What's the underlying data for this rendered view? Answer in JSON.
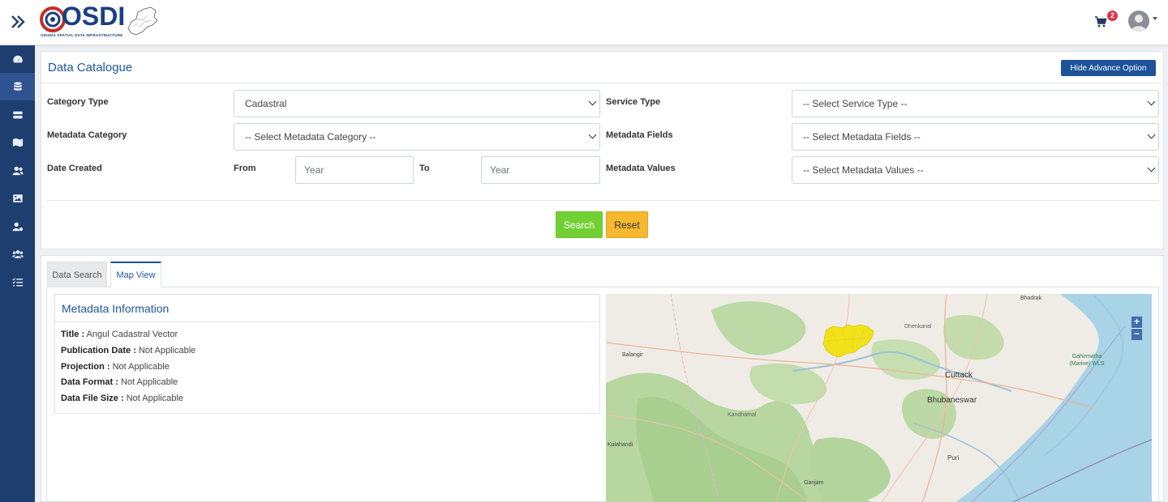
{
  "header": {
    "logo_text": "OSDI",
    "logo_subtitle": "ODISHA SPATIAL DATA INFRASTRUCTURE",
    "cart_count": "2",
    "icons": {
      "toggle": "double-chevron-right-icon",
      "cart": "cart-icon",
      "user": "user-avatar-icon"
    }
  },
  "sidebar": {
    "items": [
      {
        "icon": "dashboard-icon"
      },
      {
        "icon": "database-icon"
      },
      {
        "icon": "server-icon"
      },
      {
        "icon": "map-icon"
      },
      {
        "icon": "users-icon"
      },
      {
        "icon": "image-icon"
      },
      {
        "icon": "user-settings-icon"
      },
      {
        "icon": "user-group-icon"
      },
      {
        "icon": "checklist-icon"
      }
    ]
  },
  "catalogue": {
    "title": "Data Catalogue",
    "hide_button": "Hide Advance Option",
    "category_type_label": "Category Type",
    "category_type_value": "Cadastral",
    "service_type_label": "Service Type",
    "service_type_value": "-- Select Service Type --",
    "metadata_category_label": "Metadata Category",
    "metadata_category_value": "-- Select Metadata Category --",
    "metadata_fields_label": "Metadata Fields",
    "metadata_fields_value": "-- Select Metadata Fields --",
    "date_created_label": "Date Created",
    "from_label": "From",
    "from_placeholder": "Year",
    "to_label": "To",
    "to_placeholder": "Year",
    "metadata_values_label": "Metadata Values",
    "metadata_values_value": "-- Select Metadata Values --",
    "search_button": "Search",
    "reset_button": "Reset"
  },
  "tabs": {
    "data_search": "Data Search",
    "map_view": "Map View",
    "active": "Map View"
  },
  "metadata": {
    "title": "Metadata Information",
    "rows": [
      {
        "key": "Title :",
        "value": "Angul Cadastral Vector"
      },
      {
        "key": "Publication Date :",
        "value": "Not Applicable"
      },
      {
        "key": "Projection :",
        "value": "Not Applicable"
      },
      {
        "key": "Data Format :",
        "value": "Not Applicable"
      },
      {
        "key": "Data File Size :",
        "value": "Not Applicable"
      }
    ]
  },
  "map": {
    "zoom_in": "+",
    "zoom_out": "−",
    "places": [
      "Bhadrak",
      "Dhenkanal",
      "Balangir",
      "Cuttack",
      "Bhubaneswar",
      "Kandhamal",
      "Kalahandi",
      "Puri",
      "Ganjam",
      "Gahirmatha (Marine) WLS"
    ],
    "highlight_color": "#f4e412"
  }
}
